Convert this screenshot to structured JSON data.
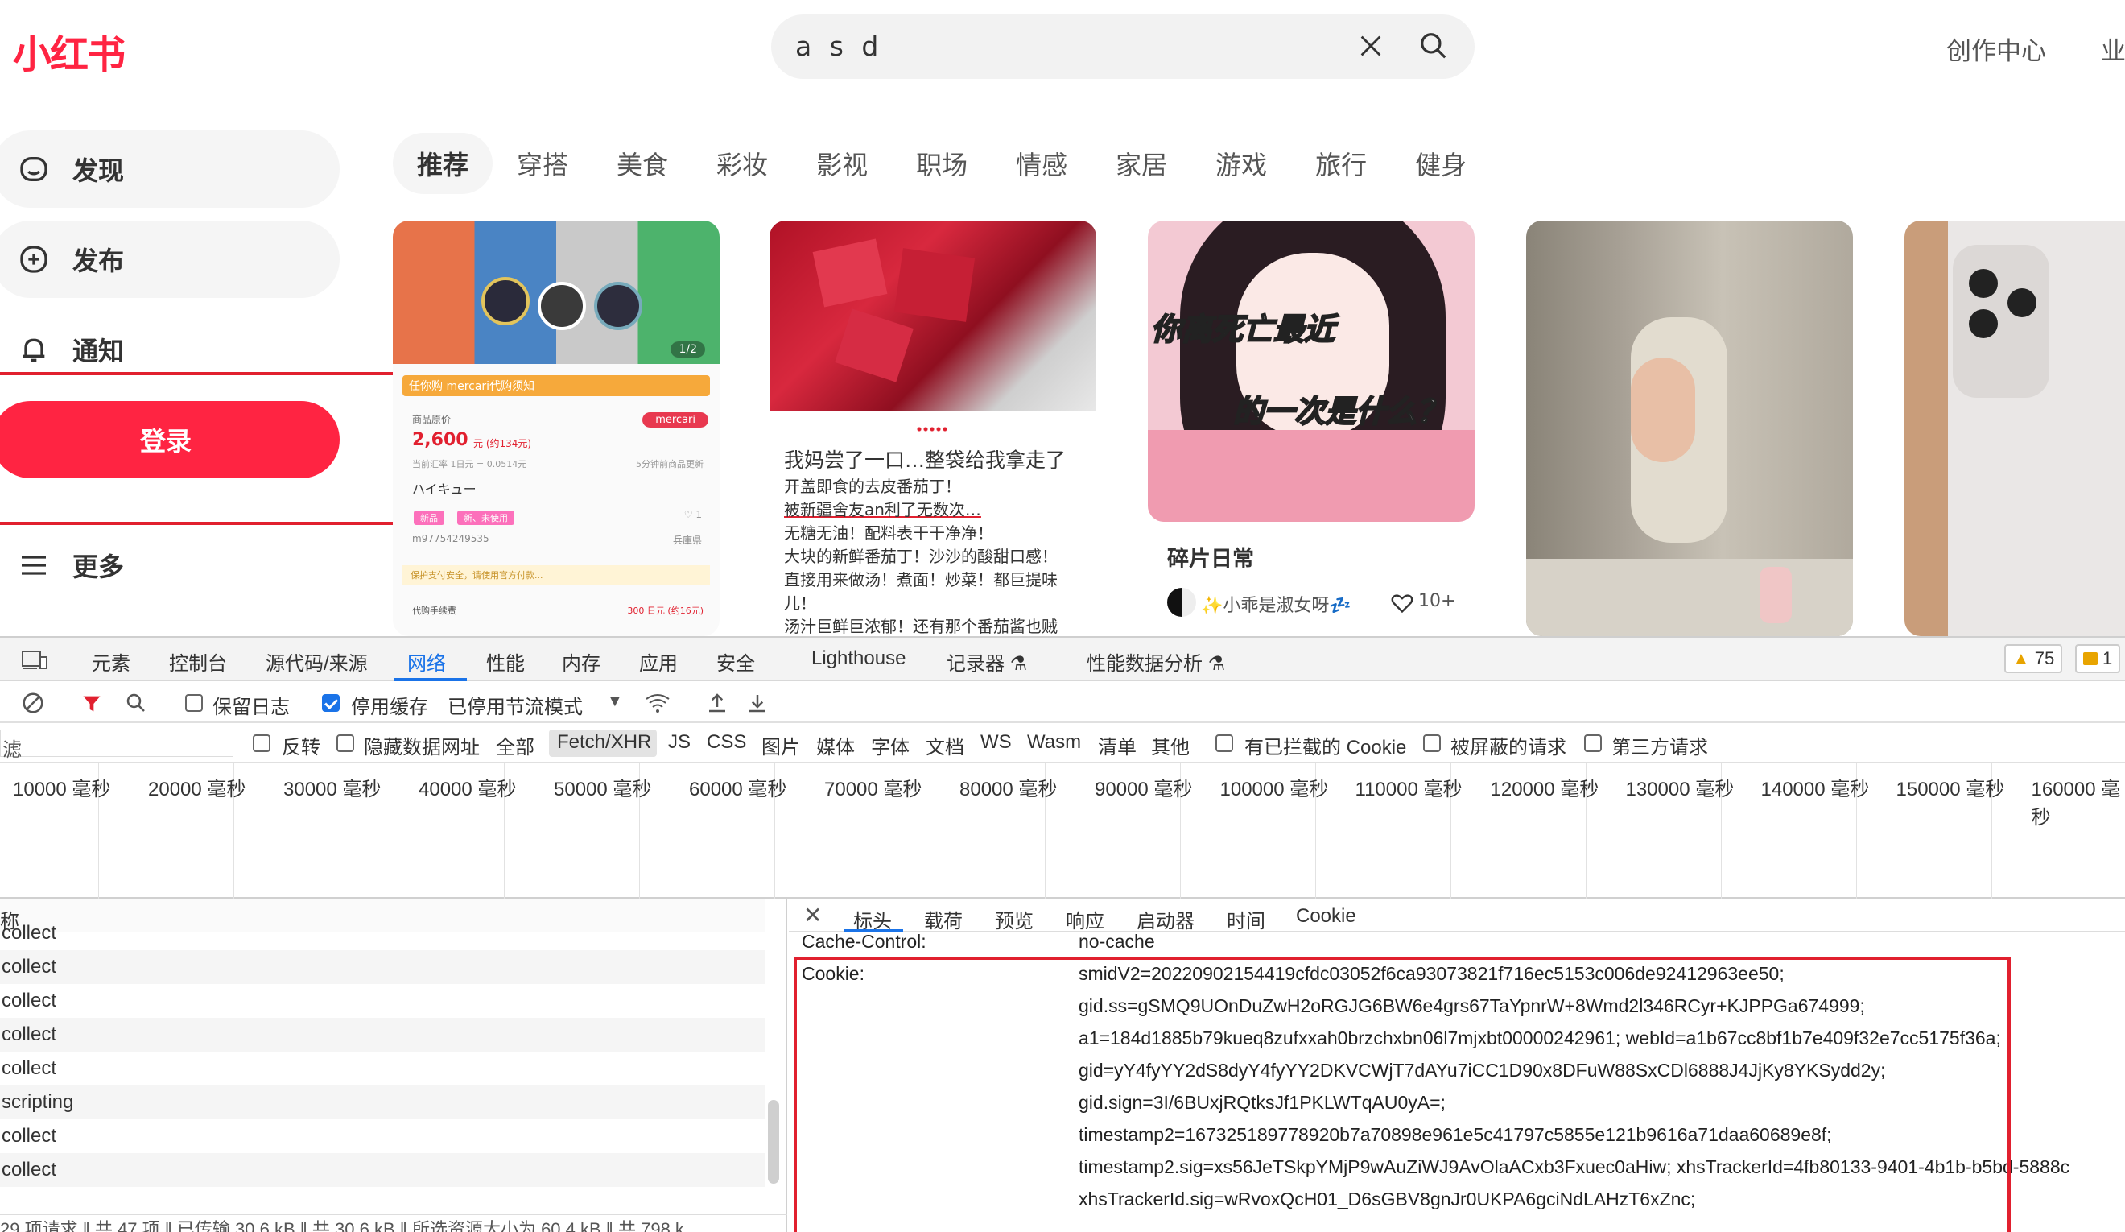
{
  "site": {
    "logo": "小红书",
    "search": {
      "query": "a s d"
    },
    "header_links": [
      "创作中心",
      "业"
    ],
    "sidebar": [
      {
        "label": "发现",
        "icon": "home-icon"
      },
      {
        "label": "发布",
        "icon": "plus-icon"
      },
      {
        "label": "通知",
        "icon": "bell-icon"
      }
    ],
    "login_label": "登录",
    "more_label": "更多",
    "channels": [
      "推荐",
      "穿搭",
      "美食",
      "彩妆",
      "影视",
      "职场",
      "情感",
      "家居",
      "游戏",
      "旅行",
      "健身"
    ],
    "card1": {
      "pager": "1/2",
      "banner": "任你购  mercari代购须知",
      "price_label": "商品原价",
      "price": "2,600",
      "price_unit": "元 (约134元)",
      "rate": "当前汇率 1日元 = 0.0514元",
      "updated": "5分钟前商品更新",
      "mercari": "mercari",
      "item_name": "ハイキュー",
      "tag1": "新品",
      "tag2": "新、未使用",
      "like": "♡ 1",
      "item_id": "m97754249535",
      "location": "兵庫県",
      "notice": "保护支付安全，请使用官方付款...",
      "fee_label": "代购手续费",
      "fee_value": "300 日元 (约16元)"
    },
    "card2": {
      "title": "我妈尝了一口…整袋给我拿走了",
      "lines": [
        "开盖即食的去皮番茄丁！",
        "被新疆舍友an利了无数次…",
        "无糖无油！配料表干干净净！",
        "大块的新鲜番茄丁！沙沙的酸甜口感！",
        "直接用来做汤！煮面！炒菜！都巨提味",
        "儿！",
        "汤汁巨鲜巨浓郁！还有那个番茄酱也贼"
      ]
    },
    "card3": {
      "overlay1": "你离死亡最近",
      "overlay2": "的一次是什么？",
      "title": "碎片日常",
      "author": "✨小乖是淑女呀💤",
      "likes": "10+"
    }
  },
  "devtools": {
    "tabs": [
      "元素",
      "控制台",
      "源代码/来源",
      "网络",
      "性能",
      "内存",
      "应用",
      "安全",
      "Lighthouse",
      "记录器 ⚗",
      "性能数据分析 ⚗"
    ],
    "active_tab": "网络",
    "warnings": "75",
    "errors": "1",
    "toolbar": {
      "preserve_log": "保留日志",
      "disable_cache": "停用缓存",
      "throttle": "已停用节流模式"
    },
    "filter_row": {
      "filter_placeholder": "滤",
      "invert": "反转",
      "hide_data_urls": "隐藏数据网址",
      "types": [
        "全部",
        "Fetch/XHR",
        "JS",
        "CSS",
        "图片",
        "媒体",
        "字体",
        "文档",
        "WS",
        "Wasm",
        "清单",
        "其他"
      ],
      "active_type": "Fetch/XHR",
      "blocked_cookies": "有已拦截的 Cookie",
      "blocked_requests": "被屏蔽的请求",
      "third_party": "第三方请求"
    },
    "timeline_labels": [
      "10000 毫秒",
      "20000 毫秒",
      "30000 毫秒",
      "40000 毫秒",
      "50000 毫秒",
      "60000 毫秒",
      "70000 毫秒",
      "80000 毫秒",
      "90000 毫秒",
      "100000 毫秒",
      "110000 毫秒",
      "120000 毫秒",
      "130000 毫秒",
      "140000 毫秒",
      "150000 毫秒",
      "160000 毫秒"
    ],
    "request_list": {
      "header": "称",
      "rows": [
        "collect",
        "collect",
        "collect",
        "collect",
        "collect",
        "scripting",
        "collect",
        "collect"
      ]
    },
    "status_bar": "29 项请求  ‖  共 47 项  ‖  已传输 30.6 kB  ‖  共 30.6 kB  ‖  所选资源大小为 60.4 kB  ‖  共 798 k",
    "detail_tabs": [
      "标头",
      "载荷",
      "预览",
      "响应",
      "启动器",
      "时间",
      "Cookie"
    ],
    "active_detail_tab": "标头",
    "headers": {
      "cache_control_name": "Cache-Control:",
      "cache_control_value": "no-cache",
      "cookie_name": "Cookie:",
      "cookie_lines": [
        "smidV2=20220902154419cfdc03052f6ca93073821f716ec5153c006de92412963ee50;",
        "gid.ss=gSMQ9UOnDuZwH2oRGJG6BW6e4grs67TaYpnrW+8Wmd2l346RCyr+KJPPGa674999;",
        "a1=184d1885b79kueq8zufxxah0brzchxbn06l7mjxbt00000242961; webId=a1b67cc8bf1b7e409f32e7cc5175f36a;",
        "gid=yY4fyYY2dS8dyY4fyYY2DKVCWjT7dAYu7iCC1D90x8DFuW88SxCDl6888J4JjKy8YKSydd2y;",
        "gid.sign=3I/6BUxjRQtksJf1PKLWTqAU0yA=;",
        "timestamp2=167325189778920b7a70898e961e5c41797c5855e121b9616a71daa60689e8f;",
        "timestamp2.sig=xs56JeTSkpYMjP9wAuZiWJ9AvOlaACxb3Fxuec0aHiw; xhsTrackerId=4fb80133-9401-4b1b-b5bd-5888c",
        "xhsTrackerId.sig=wRvoxQcH01_D6sGBV8gnJr0UKPA6gciNdLAHzT6xZnc;"
      ]
    }
  },
  "colors": {
    "brand": "#ff2442",
    "devtools_accent": "#1a73e8",
    "highlight_box": "#e1202f"
  }
}
